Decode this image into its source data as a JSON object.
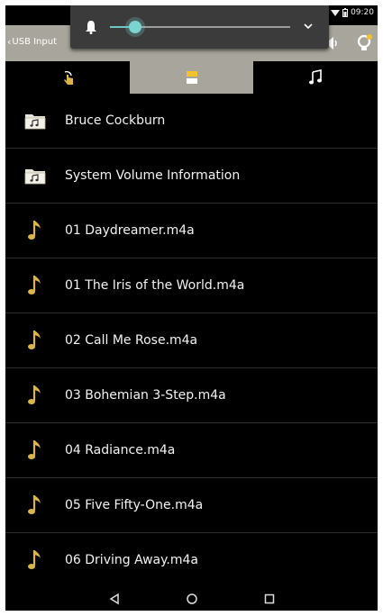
{
  "status_bar": {
    "time": "09:20",
    "icons": [
      "wifi-icon",
      "battery-icon"
    ]
  },
  "app_bar": {
    "back_label": "USB Input",
    "icons": [
      "volume-icon",
      "lightbulb-icon"
    ]
  },
  "volume_popup": {
    "level_fraction": 0.14,
    "icons": [
      "bell-icon",
      "chevron-down-icon"
    ],
    "accent_color": "#7dd3cf"
  },
  "tabs": [
    {
      "icon": "touch-icon",
      "active": false
    },
    {
      "icon": "folder-browse-icon",
      "active": true
    },
    {
      "icon": "music-note-icon",
      "active": false
    }
  ],
  "file_list": {
    "items": [
      {
        "label": "Bruce Cockburn",
        "icon": "music-folder-icon"
      },
      {
        "label": "System Volume Information",
        "icon": "music-folder-icon"
      },
      {
        "label": "01 Daydreamer.m4a",
        "icon": "music-file-icon"
      },
      {
        "label": "01 The Iris of the World.m4a",
        "icon": "music-file-icon"
      },
      {
        "label": "02 Call Me Rose.m4a",
        "icon": "music-file-icon"
      },
      {
        "label": "03 Bohemian 3-Step.m4a",
        "icon": "music-file-icon"
      },
      {
        "label": "04 Radiance.m4a",
        "icon": "music-file-icon"
      },
      {
        "label": "05 Five Fifty-One.m4a",
        "icon": "music-file-icon"
      },
      {
        "label": "06 Driving Away.m4a",
        "icon": "music-file-icon"
      }
    ]
  },
  "nav_bar": {
    "buttons": [
      "back-triangle-icon",
      "home-circle-icon",
      "recents-square-icon"
    ]
  },
  "colors": {
    "app_bar_bg": "#a8a69c",
    "list_bg": "#000000",
    "icon_gold": "#d9b54a"
  }
}
